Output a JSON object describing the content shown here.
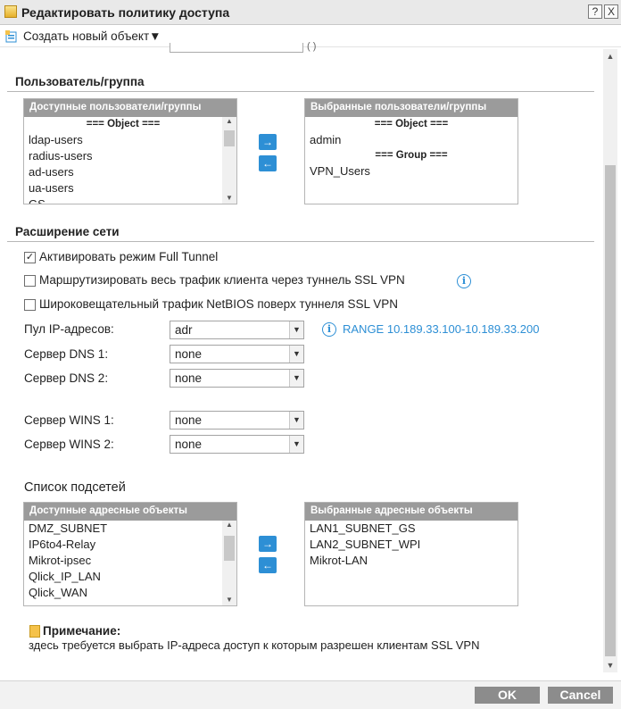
{
  "window": {
    "title": "Редактировать политику доступа",
    "help_label": "?",
    "close_label": "X"
  },
  "toolbar": {
    "create_label": "Создать новый объект▼"
  },
  "cut_row": {
    "field_text": "",
    "suffix_text": "(                    )"
  },
  "users_section": {
    "title": "Пользователь/группа",
    "available": {
      "header": "Доступные пользователи/группы",
      "group_label": "=== Object ===",
      "items": [
        "ldap-users",
        "radius-users",
        "ad-users",
        "ua-users",
        "GS"
      ]
    },
    "selected": {
      "header": "Выбранные пользователи/группы",
      "object_label": "=== Object ===",
      "object_items": [
        "admin"
      ],
      "group_label": "=== Group ===",
      "group_items": [
        "VPN_Users"
      ]
    },
    "add_arrow": "→",
    "remove_arrow": "←"
  },
  "network_section": {
    "title": "Расширение сети",
    "checkboxes": [
      {
        "label": "Активировать режим Full Tunnel",
        "checked": true,
        "mark": "✓"
      },
      {
        "label": "Маршрутизировать весь трафик клиента через туннель SSL VPN",
        "checked": false,
        "mark": ""
      },
      {
        "label": "Широковещательный трафик NetBIOS поверх туннеля SSL VPN",
        "checked": false,
        "mark": ""
      }
    ],
    "ip_pool": {
      "label": "Пул IP-адресов:",
      "value": "adr",
      "range_text": "RANGE 10.189.33.100-10.189.33.200"
    },
    "dns1": {
      "label": "Сервер DNS 1:",
      "value": "none"
    },
    "dns2": {
      "label": "Сервер DNS 2:",
      "value": "none"
    },
    "wins1": {
      "label": "Сервер WINS 1:",
      "value": "none"
    },
    "wins2": {
      "label": "Сервер WINS 2:",
      "value": "none"
    }
  },
  "subnets_section": {
    "title": "Список подсетей",
    "available": {
      "header": "Доступные адресные объекты",
      "items": [
        "DMZ_SUBNET",
        "IP6to4-Relay",
        "Mikrot-ipsec",
        "Qlick_IP_LAN",
        "Qlick_WAN"
      ]
    },
    "selected": {
      "header": "Выбранные адресные объекты",
      "items": [
        "LAN1_SUBNET_GS",
        "LAN2_SUBNET_WPI",
        "Mikrot-LAN"
      ]
    },
    "add_arrow": "→",
    "remove_arrow": "←"
  },
  "note": {
    "title": "Примечание:",
    "text": "здесь требуется выбрать IP-адреса доступ к которым разрешен клиентам SSL VPN"
  },
  "footer": {
    "ok_label": "OK",
    "cancel_label": "Cancel"
  },
  "icons": {
    "dropdown": "▼",
    "scroll_up": "▲",
    "scroll_down": "▼",
    "info": "i"
  },
  "colors": {
    "accent": "#2d8fd5",
    "list_header": "#9b9b9b",
    "button": "#8c8c8c"
  }
}
